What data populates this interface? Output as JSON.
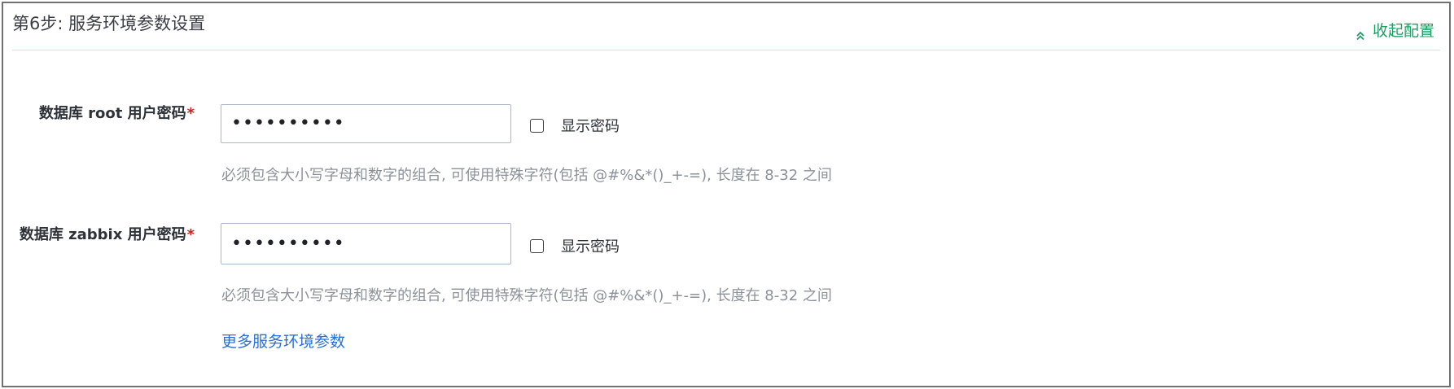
{
  "section": {
    "title": "第6步: 服务环境参数设置",
    "collapse_label": "收起配置",
    "collapse_icon": "double-chevron-up-icon",
    "accent_color": "#1e9e63"
  },
  "fields": [
    {
      "label": "数据库 root 用户密码",
      "required_mark": "*",
      "value": "••••••••••",
      "show_password_label": "显示密码",
      "show_password_checked": false,
      "hint": "必须包含大小写字母和数字的组合, 可使用特殊字符(包括 @#%&*()_+-=), 长度在 8-32 之间"
    },
    {
      "label": "数据库 zabbix 用户密码",
      "required_mark": "*",
      "value": "••••••••••",
      "show_password_label": "显示密码",
      "show_password_checked": false,
      "hint": "必须包含大小写字母和数字的组合, 可使用特殊字符(包括 @#%&*()_+-=), 长度在 8-32 之间"
    }
  ],
  "more_link": "更多服务环境参数"
}
